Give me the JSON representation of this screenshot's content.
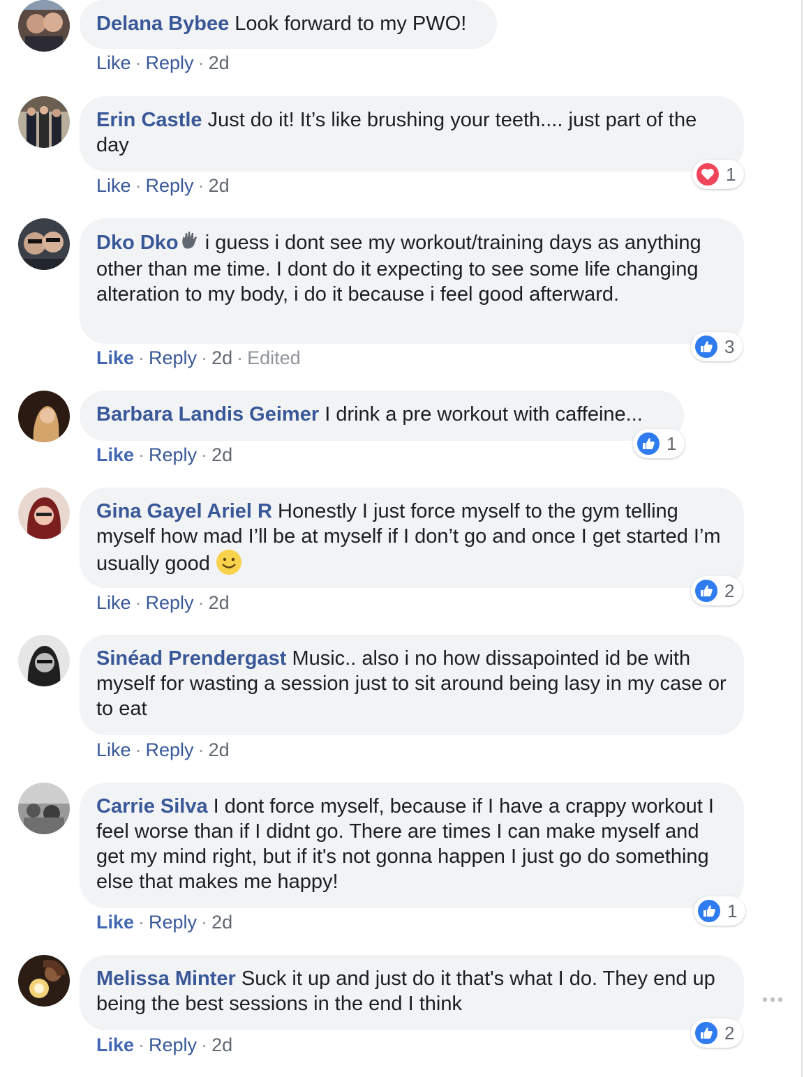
{
  "actions": {
    "like": "Like",
    "reply": "Reply",
    "dot": "·"
  },
  "colors": {
    "name": "#385898",
    "bubble": "#f2f3f5",
    "like_reaction": "#2f7bf0",
    "love_reaction": "#f0455a"
  },
  "comments": [
    {
      "author": "Delana Bybee",
      "text": "Look forward to my PWO!",
      "time": "2d"
    },
    {
      "author": "Erin Castle",
      "text": "Just do it! It’s like brushing your teeth.... just part of the day",
      "time": "2d",
      "reaction": {
        "icon": "heart-icon",
        "count": "1"
      }
    },
    {
      "author": "Dko Dko",
      "text": "i guess i dont see my workout/training days as anything other than me time. I dont do it expecting to see some life changing alteration to my body, i do it because i feel good afterward.",
      "time": "2d",
      "edited": "Edited",
      "reaction": {
        "icon": "thumbs-up-icon",
        "count": "3"
      }
    },
    {
      "author": "Barbara Landis Geimer",
      "text": "I drink a pre workout with caffeine...",
      "time": "2d",
      "reaction": {
        "icon": "thumbs-up-icon",
        "count": "1"
      }
    },
    {
      "author": "Gina Gayel Ariel R",
      "text": "Honestly I just force myself to the gym telling myself how mad I’ll be at myself if I don’t go and once I get started I’m usually good",
      "time": "2d",
      "reaction": {
        "icon": "thumbs-up-icon",
        "count": "2"
      }
    },
    {
      "author": "Sinéad Prendergast",
      "text": "Music.. also i no how dissapointed id be with myself for wasting a session just to sit around being lasy in my case or to eat",
      "time": "2d"
    },
    {
      "author": "Carrie Silva",
      "text": "I dont force myself, because if I have a crappy workout I feel worse than if I didnt go. There are times I can make myself and get my mind right, but if it's not gonna happen I just go do something else that makes me happy!",
      "time": "2d",
      "reaction": {
        "icon": "thumbs-up-icon",
        "count": "1"
      }
    },
    {
      "author": "Melissa Minter",
      "text": "Suck it up and just do it that's what I do. They end up being the best sessions in the end I think",
      "time": "2d",
      "reaction": {
        "icon": "thumbs-up-icon",
        "count": "2"
      }
    }
  ],
  "more_options_icon": "more-dots-icon"
}
